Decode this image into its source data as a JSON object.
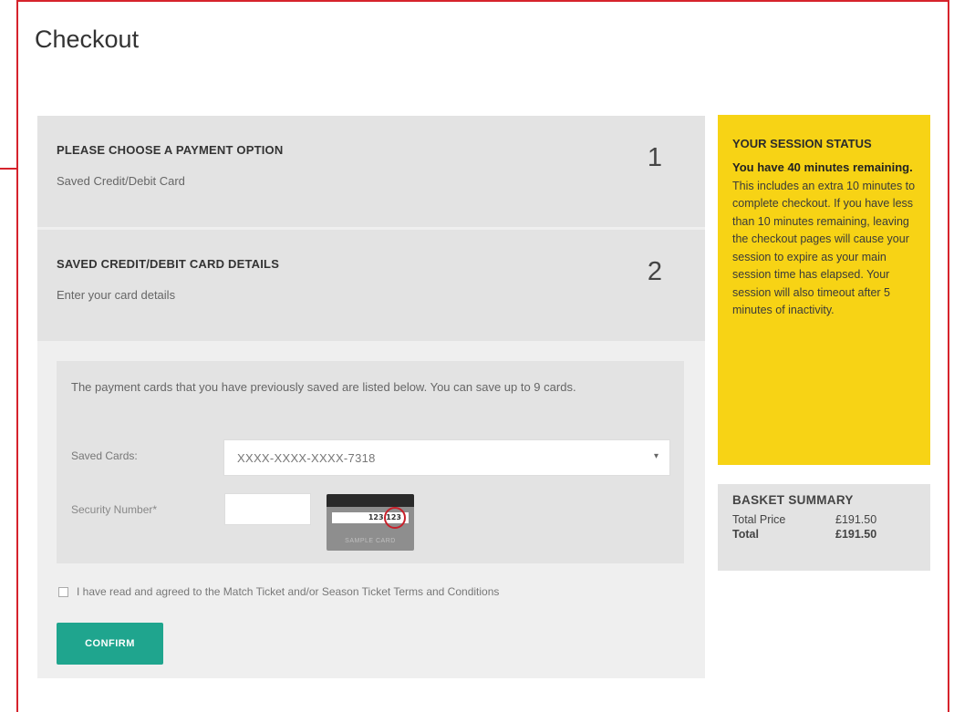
{
  "page": {
    "title": "Checkout"
  },
  "steps": [
    {
      "title": "PLEASE CHOOSE A PAYMENT OPTION",
      "subtitle": "Saved Credit/Debit Card",
      "number": "1"
    },
    {
      "title": "SAVED CREDIT/DEBIT CARD DETAILS",
      "subtitle": "Enter your card details",
      "number": "2"
    }
  ],
  "card_form": {
    "intro": "The payment cards that you have previously saved are listed below. You can save up to 9 cards.",
    "saved_cards_label": "Saved Cards:",
    "saved_cards_value": "XXXX-XXXX-XXXX-7318",
    "security_label": "Security Number*",
    "security_value": "",
    "sample_card": {
      "digits": "123 123",
      "caption": "SAMPLE CARD"
    }
  },
  "terms": {
    "checked": false,
    "text": "I have read and agreed to the Match Ticket and/or Season Ticket Terms and Conditions"
  },
  "confirm_label": "CONFIRM",
  "session": {
    "title": "YOUR SESSION STATUS",
    "bold_text": "You have 40 minutes remaining.",
    "text": " This includes an extra 10 minutes to complete checkout. If you have less than 10 minutes remaining, leaving the checkout pages will cause your session to expire as your main session time has elapsed. Your session will also timeout after 5 minutes of inactivity."
  },
  "basket": {
    "title": "BASKET SUMMARY",
    "rows": [
      {
        "label": "Total Price",
        "value": "£191.50"
      },
      {
        "label": "Total",
        "value": "£191.50"
      }
    ]
  },
  "colors": {
    "accent_border": "#d6232c",
    "confirm_button": "#1fa58e",
    "session_panel": "#f7d315"
  }
}
